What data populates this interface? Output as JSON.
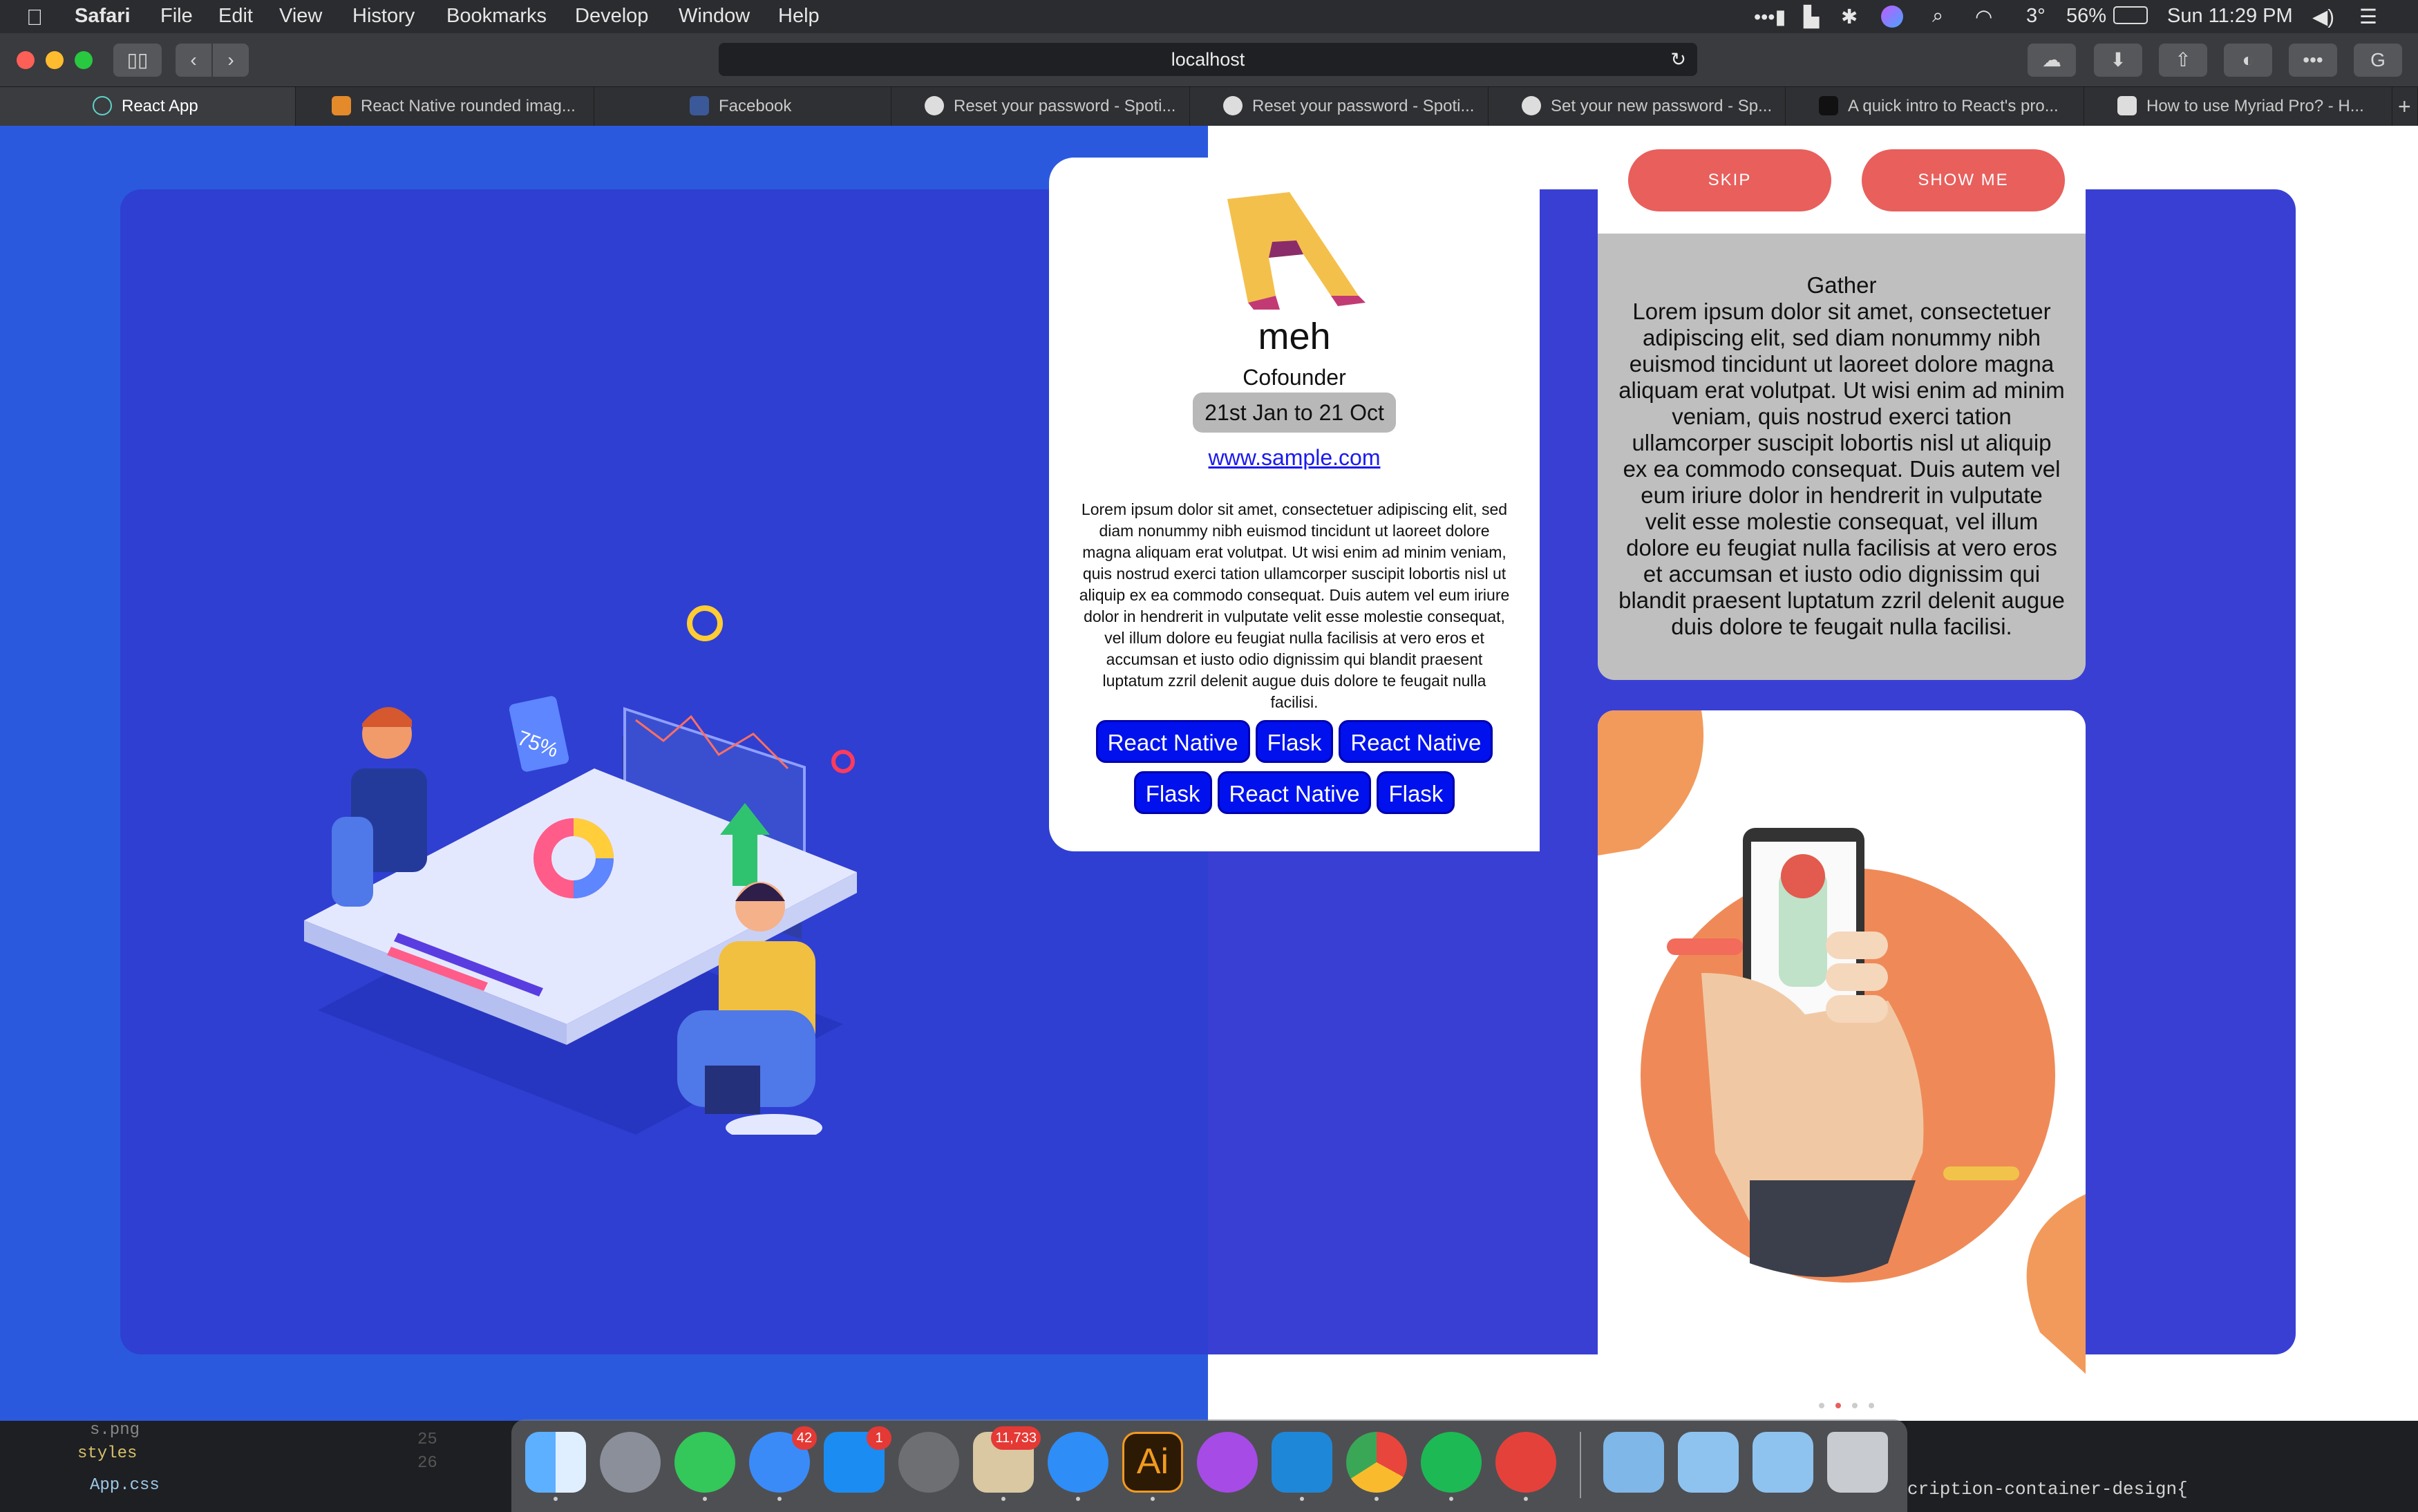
{
  "menubar": {
    "app": "Safari",
    "items": [
      "File",
      "Edit",
      "View",
      "History",
      "Bookmarks",
      "Develop",
      "Window",
      "Help"
    ],
    "status": {
      "temp": "3°",
      "battery": "56%",
      "datetime": "Sun 11:29 PM"
    }
  },
  "toolbar": {
    "url": "localhost"
  },
  "tabs": [
    {
      "label": "React App",
      "color": "#3ba9a0"
    },
    {
      "label": "React Native rounded imag...",
      "color": "#e48a2a"
    },
    {
      "label": "Facebook",
      "color": "#3b5998"
    },
    {
      "label": "Reset your password - Spoti...",
      "color": "#333"
    },
    {
      "label": "Reset your password - Spoti...",
      "color": "#333"
    },
    {
      "label": "Set your new password - Sp...",
      "color": "#333"
    },
    {
      "label": "A quick intro to React's pro...",
      "color": "#111"
    },
    {
      "label": "How to use Myriad Pro? - H...",
      "color": "#555"
    }
  ],
  "profile": {
    "name": "meh",
    "role": "Cofounder",
    "dates": "21st Jan to 21 Oct",
    "link": "www.sample.com",
    "description": "Lorem ipsum dolor sit amet, consectetuer adipiscing elit, sed diam nonummy nibh euismod tincidunt ut laoreet dolore magna aliquam erat volutpat. Ut wisi enim ad minim veniam, quis nostrud exerci tation ullamcorper suscipit lobortis nisl ut aliquip ex ea commodo consequat. Duis autem vel eum iriure dolor in hendrerit in vulputate velit esse molestie consequat, vel illum dolore eu feugiat nulla facilisis at vero eros et accumsan et iusto odio dignissim qui blandit praesent luptatum zzril delenit augue duis dolore te feugait nulla facilisi.",
    "tags": [
      "React Native",
      "Flask",
      "React Native",
      "Flask",
      "React Native",
      "Flask"
    ]
  },
  "onboarding": {
    "skip": "SKIP",
    "show_me": "SHOW ME",
    "title": "Gather",
    "text": "Lorem ipsum dolor sit amet, consectetuer adipiscing elit, sed diam nonummy nibh euismod tincidunt ut laoreet dolore magna aliquam erat volutpat. Ut wisi enim ad minim veniam, quis nostrud exerci tation ullamcorper suscipit lobortis nisl ut aliquip ex ea commodo consequat. Duis autem vel eum iriure dolor in hendrerit in vulputate velit esse molestie consequat, vel illum dolore eu feugiat nulla facilisis at vero eros et accumsan et iusto odio dignissim qui blandit praesent luptatum zzril delenit augue duis dolore te feugait nulla facilisi."
  },
  "illustration": {
    "stat": "75%"
  },
  "editor_peek": {
    "files": [
      "s.png",
      "styles",
      "App.css"
    ],
    "lines": [
      "25",
      "26"
    ],
    "code": "cription-container-design{"
  },
  "dock": {
    "badges": {
      "messages": "42",
      "appstore": "1",
      "mail": "11,733"
    },
    "ai_label": "Ai"
  }
}
